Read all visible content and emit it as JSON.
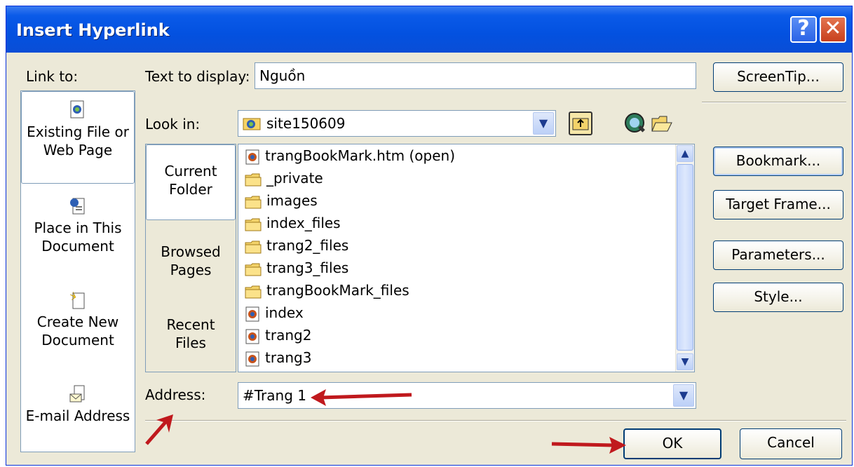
{
  "window": {
    "title": "Insert Hyperlink",
    "help_button": "?",
    "close_button": "✕"
  },
  "link_to": {
    "label": "Link to:",
    "items": [
      {
        "line1": "Existing File or",
        "line2": "Web Page"
      },
      {
        "line1": "Place in This",
        "line2": "Document"
      },
      {
        "line1": "Create New",
        "line2": "Document"
      },
      {
        "line1": "E-mail Address",
        "line2": ""
      }
    ]
  },
  "text_to_display": {
    "label": "Text to display:",
    "value": "Nguồn"
  },
  "look_in": {
    "label": "Look in:",
    "value": "site150609"
  },
  "nav": {
    "items": [
      {
        "line1": "Current",
        "line2": "Folder"
      },
      {
        "line1": "Browsed",
        "line2": "Pages"
      },
      {
        "line1": "Recent",
        "line2": "Files"
      }
    ]
  },
  "files": [
    {
      "name": "trangBookMark.htm (open)",
      "type": "page"
    },
    {
      "name": "_private",
      "type": "folder"
    },
    {
      "name": "images",
      "type": "folder"
    },
    {
      "name": "index_files",
      "type": "folder"
    },
    {
      "name": "trang2_files",
      "type": "folder"
    },
    {
      "name": "trang3_files",
      "type": "folder"
    },
    {
      "name": "trangBookMark_files",
      "type": "folder"
    },
    {
      "name": "index",
      "type": "page"
    },
    {
      "name": "trang2",
      "type": "page"
    },
    {
      "name": "trang3",
      "type": "page"
    }
  ],
  "address": {
    "label": "Address:",
    "value": "#Trang 1"
  },
  "buttons": {
    "screentip": "ScreenTip...",
    "bookmark": "Bookmark...",
    "target_frame": "Target Frame...",
    "parameters": "Parameters...",
    "style": "Style...",
    "ok": "OK",
    "cancel": "Cancel"
  },
  "colors": {
    "title_bar": "#0a4ed6",
    "dialog_bg": "#ece9d8",
    "annotation_arrow": "#c0191d"
  }
}
